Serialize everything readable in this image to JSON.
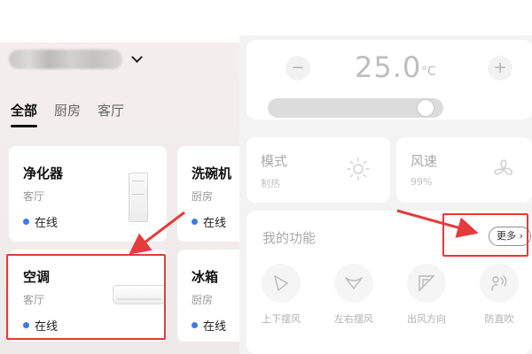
{
  "home": {
    "name_label": "",
    "chevron_icon": "chevron-down-icon"
  },
  "room_tabs": [
    {
      "label": "全部",
      "active": true
    },
    {
      "label": "厨房",
      "active": false
    },
    {
      "label": "客厅",
      "active": false
    }
  ],
  "devices": [
    {
      "name": "净化器",
      "room": "客厅",
      "status": "在线",
      "icon": "air-purifier-icon"
    },
    {
      "name": "洗碗机",
      "room": "厨房",
      "status": "在线"
    },
    {
      "name": "空调",
      "room": "客厅",
      "status": "在线",
      "icon": "air-conditioner-icon",
      "highlighted": true
    },
    {
      "name": "冰箱",
      "room": "厨房",
      "status": "在线"
    }
  ],
  "temperature": {
    "value": "25.0",
    "unit": "°C",
    "minus_icon": "minus",
    "plus_icon": "plus",
    "decrease_label": "−",
    "increase_label": "+",
    "slider_level": 0.9
  },
  "mode": {
    "title": "模式",
    "value": "制热",
    "icon": "sun-icon"
  },
  "fan": {
    "title": "风速",
    "value": "99%",
    "icon": "fan-icon"
  },
  "functions": {
    "title": "我的功能",
    "more_label": "更多",
    "more_icon": "chevron-right-icon",
    "items": [
      {
        "label": "上下摆风",
        "icon": "vertical-swing-icon"
      },
      {
        "label": "左右摆风",
        "icon": "horizontal-swing-icon"
      },
      {
        "label": "出风方向",
        "icon": "airflow-direction-icon"
      },
      {
        "label": "防直吹",
        "icon": "anti-direct-blow-icon"
      }
    ]
  },
  "colors": {
    "accent_blue": "#3b7be8",
    "annotation_red": "#e53b3b",
    "panel_bg": "#f3f3f3"
  }
}
